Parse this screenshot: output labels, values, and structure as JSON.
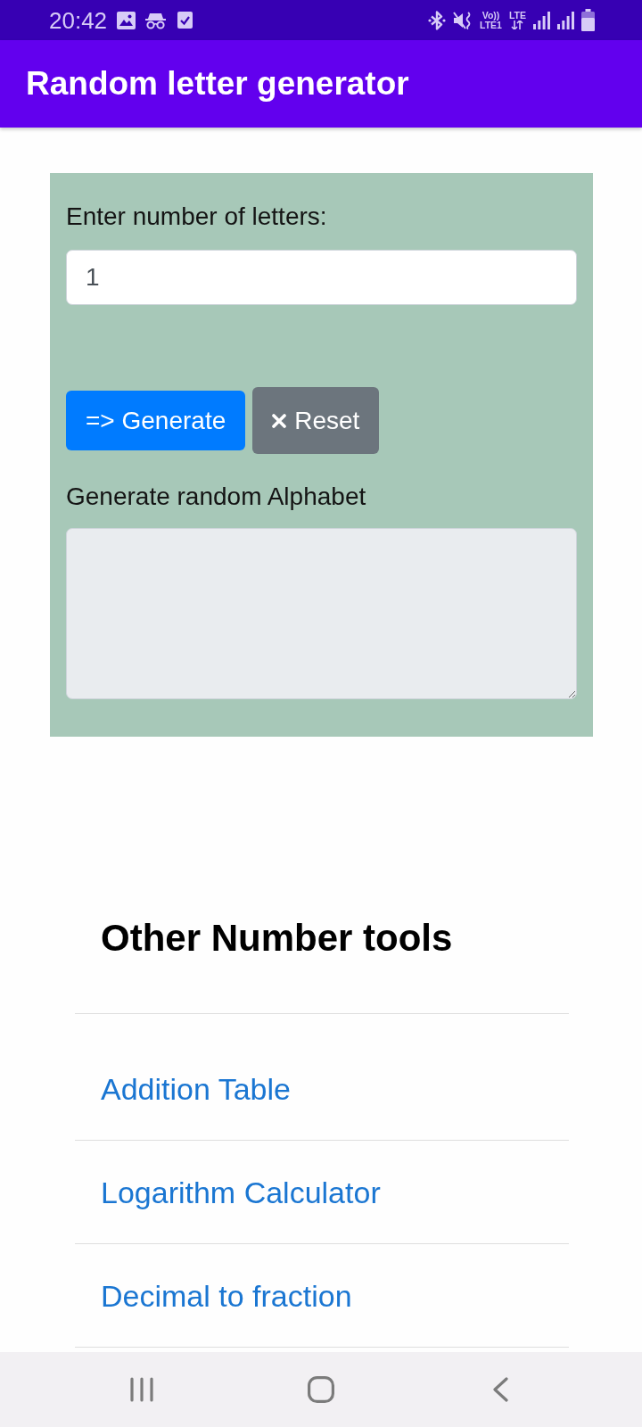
{
  "status_bar": {
    "time": "20:42",
    "volte": [
      "Vo))",
      "LTE1"
    ],
    "network": "LTE"
  },
  "app_bar": {
    "title": "Random letter generator"
  },
  "form": {
    "count_label": "Enter number of letters:",
    "count_field": {
      "value": "1"
    },
    "buttons": [
      {
        "kind": "generate",
        "label": "=> Generate"
      },
      {
        "kind": "reset",
        "label": "Reset"
      }
    ],
    "output_label": "Generate random Alphabet",
    "output_field": {
      "readonly": true
    }
  },
  "other_tools": {
    "heading": "Other Number tools",
    "links": [
      "Addition Table",
      "Logarithm Calculator",
      "Decimal to fraction"
    ]
  }
}
